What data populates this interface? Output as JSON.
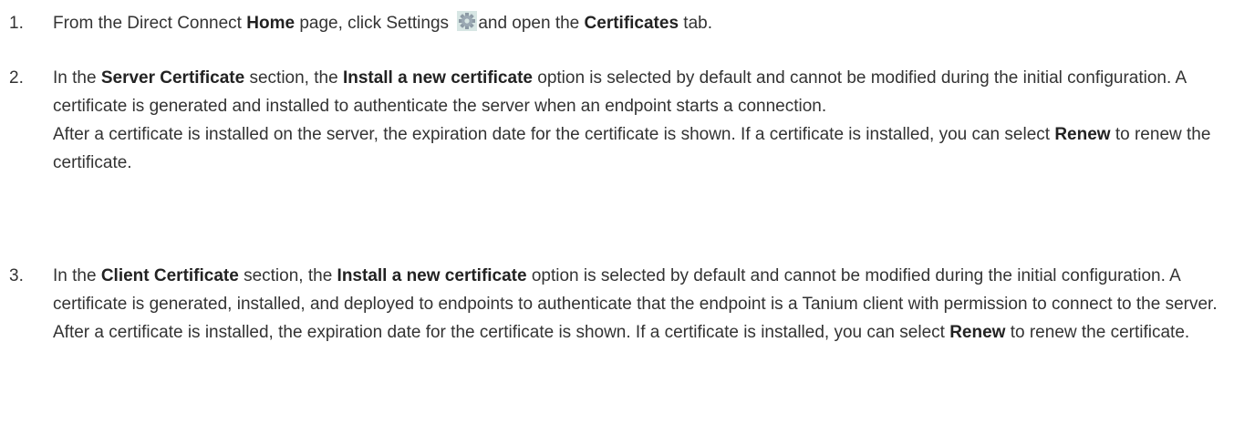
{
  "steps": [
    {
      "number": "1.",
      "t1": "From the Direct Connect ",
      "b1": "Home",
      "t2": " page, click Settings ",
      "icon": "gear-icon",
      "t3": "and open the ",
      "b2": "Certificates",
      "t4": " tab."
    },
    {
      "number": "2.",
      "t1": "In the ",
      "b1": "Server Certificate",
      "t2": " section, the ",
      "b2": "Install a new certificate",
      "t3": " option is selected by default and cannot be modified during the initial configuration. A certificate is generated and installed to authenticate the server when an endpoint starts a connection.",
      "p2_t1": "After a certificate is installed on the server, the expiration date for the certificate is shown. If a certificate is installed, you can select ",
      "p2_b1": "Renew",
      "p2_t2": " to renew the certificate."
    },
    {
      "number": "3.",
      "t1": "In the ",
      "b1": "Client Certificate",
      "t2": " section, the ",
      "b2": "Install a new certificate",
      "t3": " option is selected by default and cannot be modified during the initial configuration. A certificate is generated, installed, and deployed to endpoints to authenticate that the endpoint is a Tanium client with permission to connect to the server.",
      "p2_t1": "After a certificate is installed, the expiration date for the certificate is shown. If a certificate is installed, you can select ",
      "p2_b1": "Renew",
      "p2_t2": " to renew the certificate."
    }
  ]
}
